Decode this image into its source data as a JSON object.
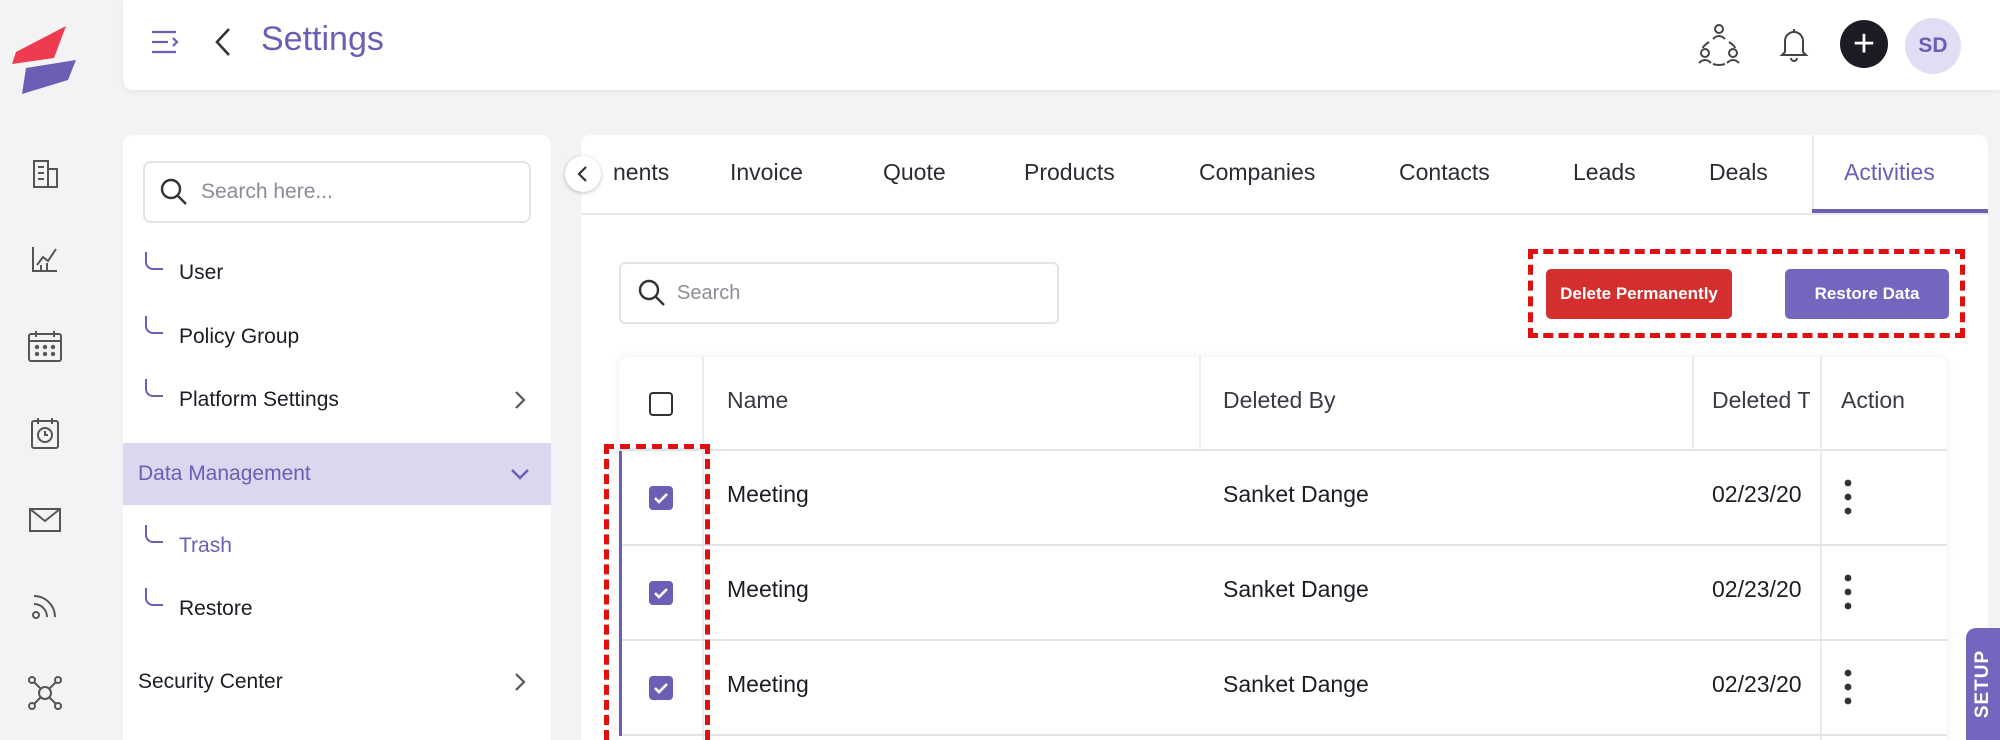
{
  "header": {
    "title": "Settings",
    "avatar_initials": "SD"
  },
  "side": {
    "search_placeholder": "Search here...",
    "items": [
      {
        "label": "User"
      },
      {
        "label": "Policy Group"
      },
      {
        "label": "Platform Settings"
      },
      {
        "label": "Data Management"
      },
      {
        "label": "Trash"
      },
      {
        "label": "Restore"
      },
      {
        "label": "Security Center"
      }
    ]
  },
  "tabs": [
    {
      "label": "nents"
    },
    {
      "label": "Invoice"
    },
    {
      "label": "Quote"
    },
    {
      "label": "Products"
    },
    {
      "label": "Companies"
    },
    {
      "label": "Contacts"
    },
    {
      "label": "Leads"
    },
    {
      "label": "Deals"
    },
    {
      "label": "Activities",
      "active": true
    }
  ],
  "toolbar": {
    "search_placeholder": "Search",
    "delete_label": "Delete Permanently",
    "restore_label": "Restore Data"
  },
  "table": {
    "columns": [
      "Name",
      "Deleted By",
      "Deleted T",
      "Action"
    ],
    "rows": [
      {
        "name": "Meeting",
        "deleted_by": "Sanket Dange",
        "deleted_time": "02/23/20",
        "checked": true
      },
      {
        "name": "Meeting",
        "deleted_by": "Sanket Dange",
        "deleted_time": "02/23/20",
        "checked": true
      },
      {
        "name": "Meeting",
        "deleted_by": "Sanket Dange",
        "deleted_time": "02/23/20",
        "checked": true
      }
    ]
  },
  "setup_tab": "SETUP",
  "colors": {
    "accent": "#6a5eb5",
    "danger": "#d42f2f",
    "highlight": "#e01010"
  }
}
